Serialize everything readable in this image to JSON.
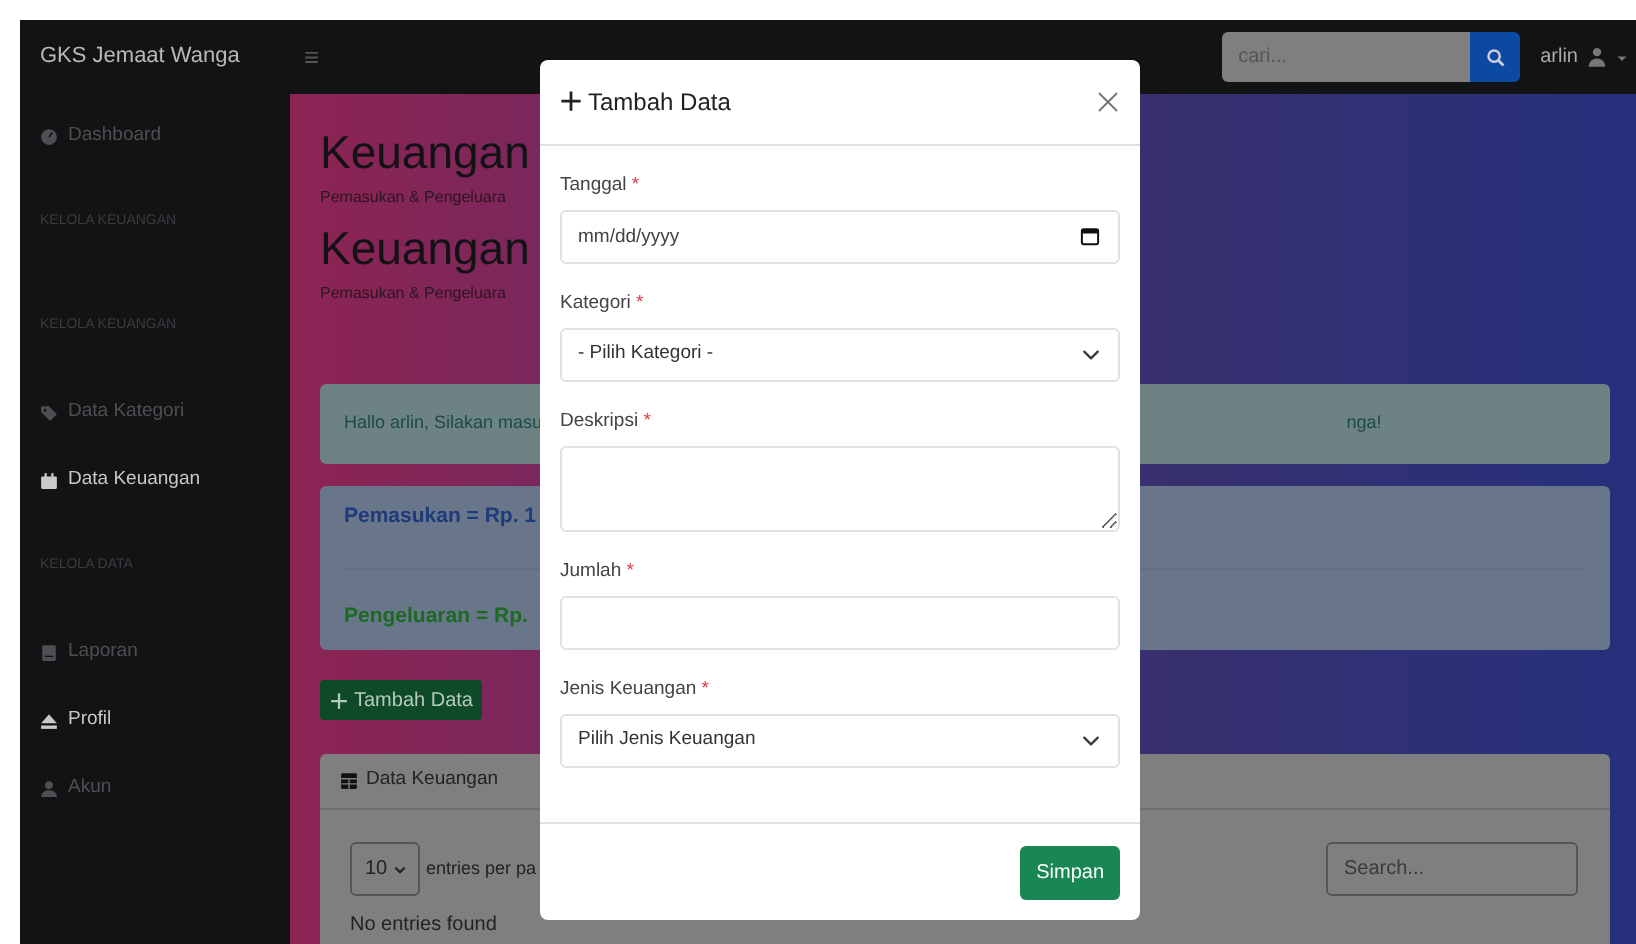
{
  "navbar": {
    "brand": "GKS Jemaat Wanga",
    "menu_icon": "≡",
    "search": {
      "placeholder": "cari..."
    },
    "user": "arlin"
  },
  "sidebar": {
    "items": [
      {
        "kind": "link",
        "label": "Dashboard",
        "highlighted": false
      },
      {
        "kind": "heading",
        "label": "KELOLA KEUANGAN"
      },
      {
        "kind": "heading",
        "label": "KELOLA KEUANGAN"
      },
      {
        "kind": "link",
        "label": "Data Kategori",
        "highlighted": false
      },
      {
        "kind": "link",
        "label": "Data Keuangan",
        "highlighted": true
      },
      {
        "kind": "heading",
        "label": "KELOLA DATA"
      },
      {
        "kind": "link",
        "label": "Laporan",
        "highlighted": false
      },
      {
        "kind": "link",
        "label": "Profil",
        "highlighted": true
      },
      {
        "kind": "link",
        "label": "Akun",
        "highlighted": false
      }
    ]
  },
  "content": {
    "headings": [
      {
        "title": "Keuangan",
        "subtitle": "Pemasukan & Pengeluara"
      },
      {
        "title": "Keuangan",
        "subtitle": "Pemasukan & Pengeluara"
      }
    ],
    "alert": {
      "text_left": "Hallo arlin, Silakan masu",
      "text_right": "nga!"
    },
    "summary": [
      {
        "text": "Pemasukan = Rp. 1",
        "color": "#1d3b7c"
      },
      {
        "text": "Pengeluaran = Rp.",
        "color": "#1c6a22"
      }
    ],
    "add_button": "Tambah Data",
    "table_card": {
      "title": "Data Keuangan",
      "page_size": "10",
      "page_size_label": "entries per pa",
      "search_placeholder": "Search...",
      "empty": "No entries found"
    }
  },
  "modal": {
    "title": "Tambah Data",
    "fields": [
      {
        "kind": "date",
        "label": "Tanggal",
        "mark": "*",
        "placeholder": "mm/dd/yyyy"
      },
      {
        "kind": "select",
        "label": "Kategori",
        "mark": "*",
        "value": "- Pilih Kategori -"
      },
      {
        "kind": "textarea",
        "label": "Deskripsi",
        "mark": "*"
      },
      {
        "kind": "text",
        "label": "Jumlah",
        "mark": "*"
      },
      {
        "kind": "select",
        "label": "Jenis Keuangan",
        "mark": "*",
        "value": "Pilih Jenis Keuangan"
      }
    ],
    "submit": "Simpan"
  }
}
